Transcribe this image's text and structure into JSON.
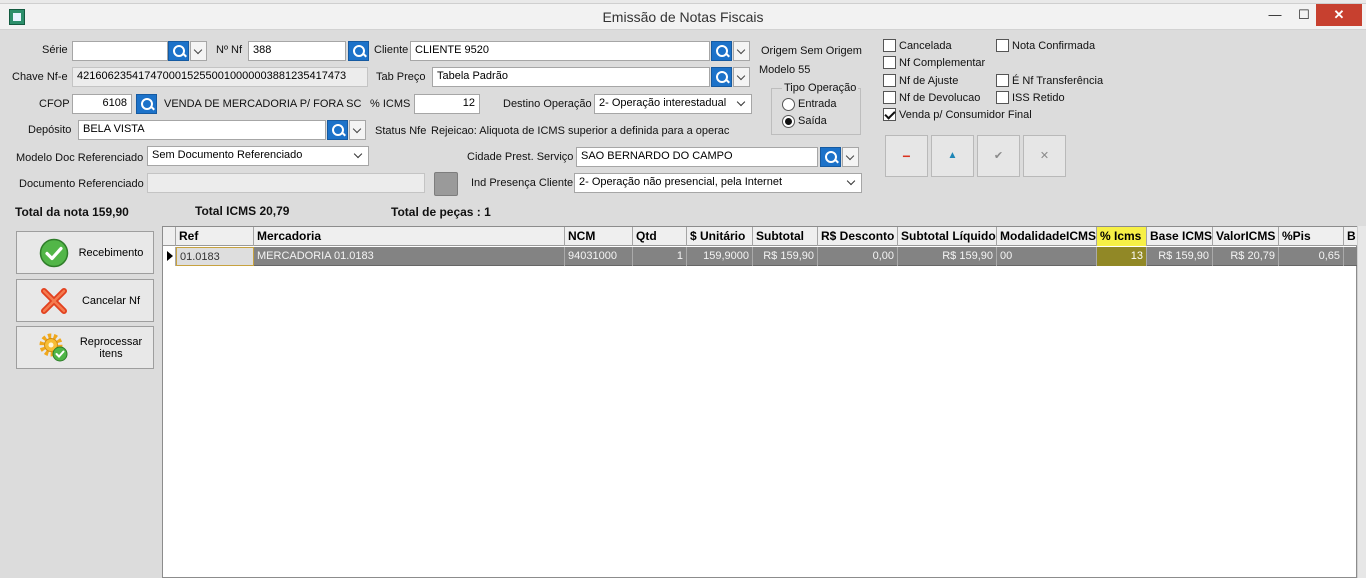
{
  "window": {
    "title": "Emissão de Notas Fiscais",
    "min_glyph": "—",
    "max_glyph": "☐",
    "close_glyph": "✕"
  },
  "form": {
    "serie_label": "Série",
    "serie_value": "",
    "nf_label": "Nº Nf",
    "nf_value": "388",
    "cliente_label": "Cliente",
    "cliente_value": "CLIENTE 9520",
    "origem_text": "Origem Sem Origem",
    "modelo_text": "Modelo 55",
    "chave_label": "Chave Nf-e",
    "chave_value": "42160623541747000152550010000003881235417473",
    "tabpreco_label": "Tab Preço",
    "tabpreco_value": "Tabela Padrão",
    "cfop_label": "CFOP",
    "cfop_value": "6108",
    "cfop_desc": "VENDA DE MERCADORIA P/ FORA SC",
    "icms_label": "% ICMS",
    "icms_value": "12",
    "destino_label": "Destino Operação",
    "destino_value": "2- Operação interestadual",
    "deposito_label": "Depósito",
    "deposito_value": "BELA VISTA",
    "status_label": "Status Nfe",
    "status_value": "Rejeicao: Aliquota de ICMS superior a definida para a operac",
    "modelo_ref_label": "Modelo Doc Referenciado",
    "modelo_ref_value": "Sem Documento Referenciado",
    "cidade_label": "Cidade Prest. Serviço",
    "cidade_value": "SAO BERNARDO DO CAMPO",
    "doc_ref_label": "Documento Referenciado",
    "doc_ref_value": "",
    "ind_presenca_label": "Ind Presença Cliente",
    "ind_presenca_value": "2- Operação não presencial, pela Internet"
  },
  "tipo_operacao": {
    "label": "Tipo Operação",
    "entrada": "Entrada",
    "saida": "Saída",
    "selected": "Saída"
  },
  "checkboxes": {
    "cancelada": {
      "label": "Cancelada",
      "checked": false
    },
    "nf_complementar": {
      "label": "Nf Complementar",
      "checked": false
    },
    "nf_ajuste": {
      "label": "Nf de Ajuste",
      "checked": false
    },
    "nf_devolucao": {
      "label": "Nf de Devolucao",
      "checked": false
    },
    "venda_consumidor": {
      "label": "Venda p/ Consumidor Final",
      "checked": true
    },
    "nota_confirmada": {
      "label": "Nota Confirmada",
      "checked": false
    },
    "nf_transferencia": {
      "label": "É Nf Transferência",
      "checked": false
    },
    "iss_retido": {
      "label": "ISS Retido",
      "checked": false
    }
  },
  "actions": {
    "delete_glyph": "−",
    "up_glyph": "▲",
    "confirm_glyph": "✔",
    "cancel_glyph": "✕"
  },
  "colors": {
    "delete": "#d9321f",
    "up": "#1e86b6",
    "confirm": "#8a8a8a",
    "cancel": "#8a8a8a"
  },
  "totals": {
    "total_nota": "Total da nota 159,90",
    "total_icms": "Total ICMS 20,79",
    "total_pecas": "Total de peças : 1"
  },
  "sidebar": {
    "recebimento": "Recebimento",
    "cancelar": "Cancelar Nf",
    "reprocessar": "Reprocessar itens"
  },
  "grid": {
    "headers": [
      "Ref",
      "Mercadoria",
      "NCM",
      "Qtd",
      "$ Unitário",
      "Subtotal",
      "R$ Desconto",
      "Subtotal Líquido",
      "ModalidadeICMS",
      "% Icms",
      "Base ICMS",
      "ValorICMS",
      "%Pis",
      "B"
    ],
    "rows": [
      [
        "01.0183",
        "MERCADORIA 01.0183",
        "94031000",
        "1",
        "159,9000",
        "R$ 159,90",
        "0,00",
        "R$ 159,90",
        "00",
        "13",
        "R$ 159,90",
        "R$ 20,79",
        "0,65",
        ""
      ]
    ]
  }
}
